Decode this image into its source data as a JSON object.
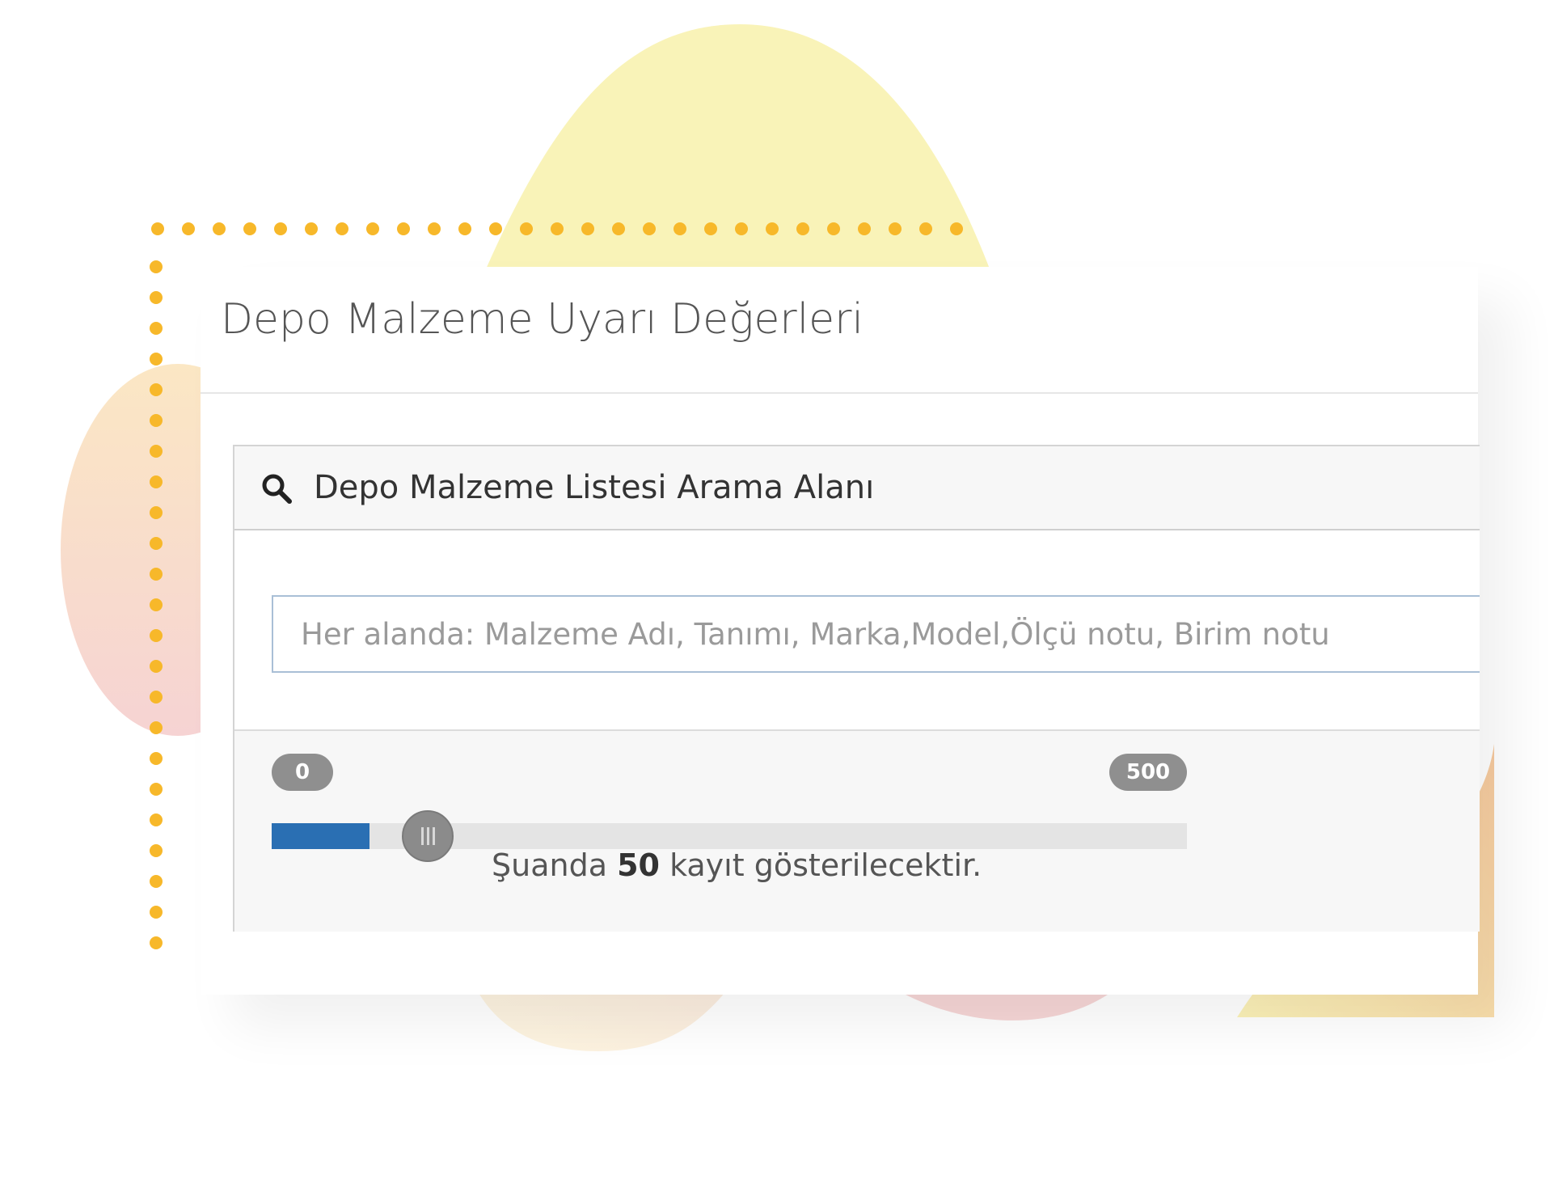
{
  "page": {
    "title": "Depo Malzeme Uyarı Değerleri"
  },
  "search_panel": {
    "icon": "search-icon",
    "title": "Depo Malzeme Listesi Arama Alanı",
    "input_value": "",
    "input_placeholder": "Her alanda: Malzeme Adı, Tanımı, Marka,Model,Ölçü notu, Birim notu"
  },
  "record_slider": {
    "min_label": "0",
    "max_label": "500",
    "min": 0,
    "max": 500,
    "value": 50,
    "status_prefix": "Şuanda",
    "status_value": "50",
    "status_suffix": "kayıt gösterilecektir."
  },
  "colors": {
    "accent_blue": "#2a6fb3",
    "dot_orange": "#f7b82a",
    "blob_yellow": "#f9f3b8",
    "blob_pink": "#f6d6d6",
    "blob_peach": "#f7d0a8"
  }
}
